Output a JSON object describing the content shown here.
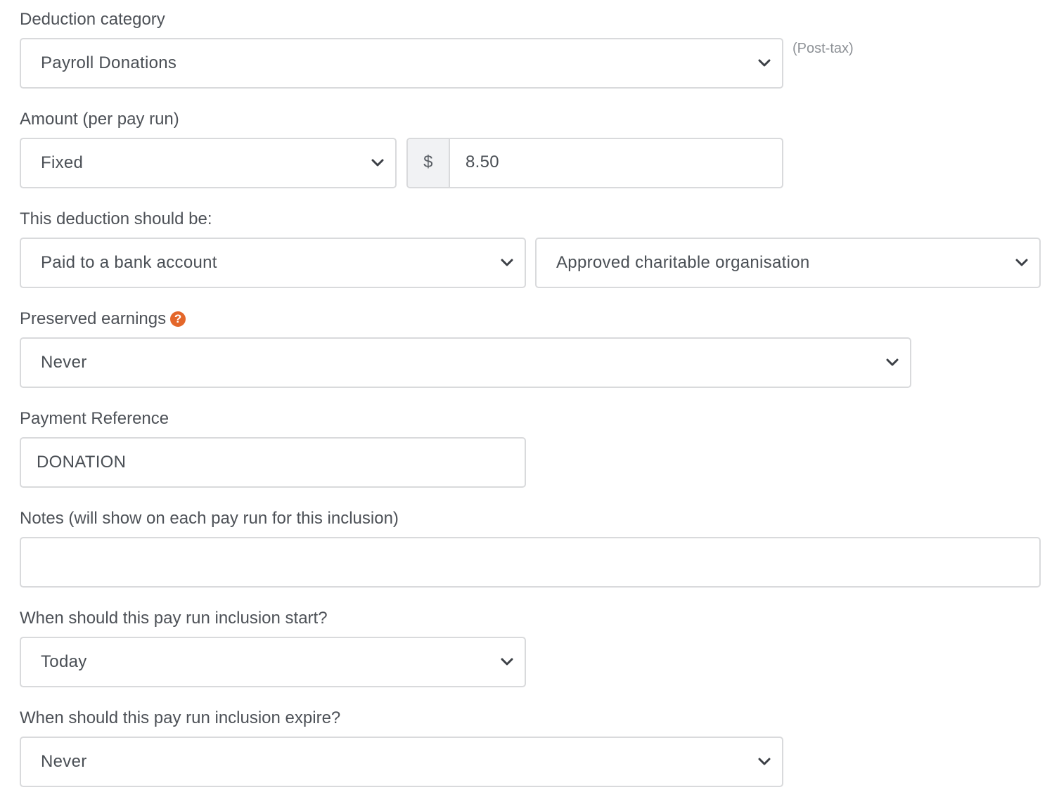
{
  "deduction_category": {
    "label": "Deduction category",
    "value": "Payroll Donations",
    "hint": "(Post-tax)"
  },
  "amount": {
    "label": "Amount (per pay run)",
    "type_value": "Fixed",
    "currency_symbol": "$",
    "value": "8.50"
  },
  "deduction_destination": {
    "label": "This deduction should be:",
    "payee_type": "Paid to a bank account",
    "payee": "Approved charitable organisation"
  },
  "preserved_earnings": {
    "label": "Preserved earnings",
    "help_icon_glyph": "?",
    "value": "Never"
  },
  "payment_reference": {
    "label": "Payment Reference",
    "value": "DONATION"
  },
  "notes": {
    "label": "Notes (will show on each pay run for this inclusion)",
    "value": ""
  },
  "start": {
    "label": "When should this pay run inclusion start?",
    "value": "Today"
  },
  "expire": {
    "label": "When should this pay run inclusion expire?",
    "value": "Never"
  },
  "icons": {
    "dropdown": "chevron-down-icon",
    "help": "question-circle-icon"
  },
  "colors": {
    "help_icon": "#e4672a",
    "border": "#d9dadc",
    "label_text": "#4d5157",
    "hint_text": "#8d9196",
    "addon_bg": "#f1f2f4"
  }
}
